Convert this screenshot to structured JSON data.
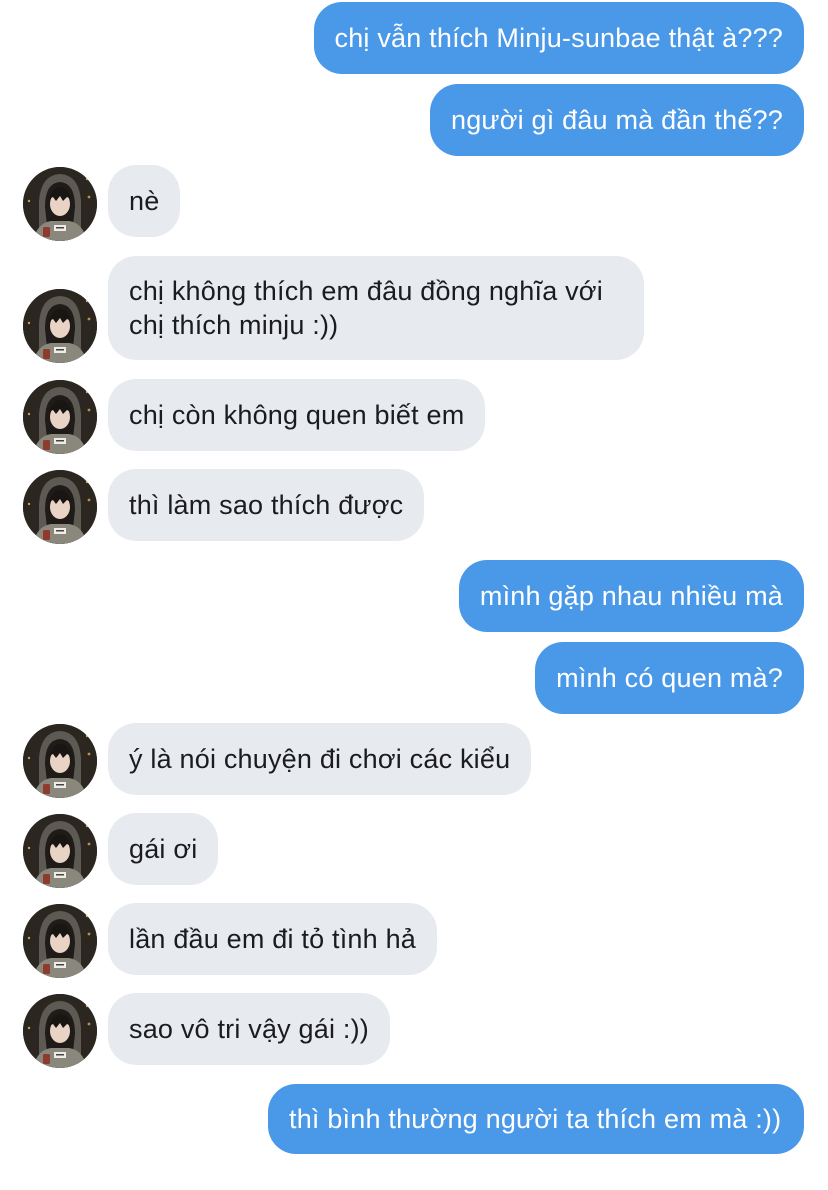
{
  "conversation": {
    "messages": [
      {
        "sender": "me",
        "text": "chị vẫn thích Minju-sunbae thật à???"
      },
      {
        "sender": "me",
        "text": "người gì đâu mà đần thế??"
      },
      {
        "sender": "them",
        "text": "nè"
      },
      {
        "sender": "them",
        "text": "chị không thích em đâu đồng nghĩa với chị thích minju :))"
      },
      {
        "sender": "them",
        "text": "chị còn không quen biết em"
      },
      {
        "sender": "them",
        "text": "thì làm sao thích được"
      },
      {
        "sender": "me",
        "text": "mình gặp nhau nhiều mà"
      },
      {
        "sender": "me",
        "text": "mình có quen mà?"
      },
      {
        "sender": "them",
        "text": "ý là nói chuyện đi chơi các kiểu"
      },
      {
        "sender": "them",
        "text": "gái ơi"
      },
      {
        "sender": "them",
        "text": "lần đầu em đi tỏ tình hả"
      },
      {
        "sender": "them",
        "text": "sao vô tri vậy gái :))"
      },
      {
        "sender": "me",
        "text": "thì bình thường người ta thích em mà :))"
      }
    ]
  },
  "colors": {
    "sent_bubble": "#4a98e8",
    "received_bubble": "#e7eaef",
    "background": "#ffffff"
  },
  "avatar_icon": "contact-avatar-photo"
}
